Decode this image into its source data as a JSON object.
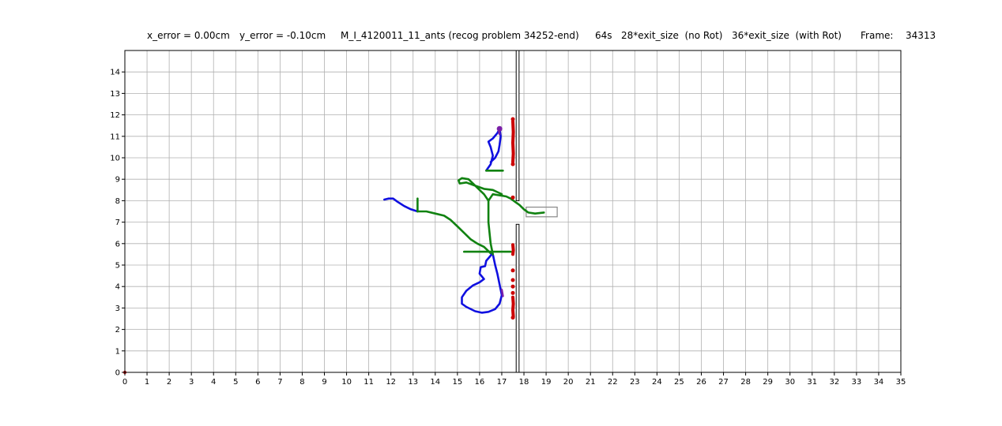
{
  "title_parts": {
    "x_error": "x_error = 0.00cm",
    "y_error": "y_error = -0.10cm",
    "experiment": "M_I_4120011_11_ants (recog problem 34252-end)",
    "time": "64s",
    "no_rot": "28*exit_size  (no Rot)",
    "with_rot": "36*exit_size  (with Rot)",
    "frame_label": "Frame:",
    "frame_value": "34313"
  },
  "chart_data": {
    "type": "line",
    "xlim": [
      0,
      35
    ],
    "ylim": [
      0,
      15
    ],
    "xticks": [
      0,
      1,
      2,
      3,
      4,
      5,
      6,
      7,
      8,
      9,
      10,
      11,
      12,
      13,
      14,
      15,
      16,
      17,
      18,
      19,
      20,
      21,
      22,
      23,
      24,
      25,
      26,
      27,
      28,
      29,
      30,
      31,
      32,
      33,
      34,
      35
    ],
    "yticks": [
      0,
      1,
      2,
      3,
      4,
      5,
      6,
      7,
      8,
      9,
      10,
      11,
      12,
      13,
      14
    ],
    "grid": true,
    "colors": {
      "blue": "#1010e0",
      "green": "#118211",
      "red": "#cc0000",
      "purple": "#7a1fa8",
      "gray_box": "#888888"
    },
    "walls": [
      {
        "x": [
          17.65,
          17.78
        ],
        "y": [
          8.0,
          15.0
        ]
      },
      {
        "x": [
          17.65,
          17.78
        ],
        "y": [
          0.0,
          6.9
        ]
      }
    ],
    "exit_box": {
      "x": [
        18.1,
        19.5
      ],
      "y": [
        7.25,
        7.7
      ]
    },
    "series": [
      {
        "color": "blue",
        "values": [
          [
            11.7,
            8.05
          ],
          [
            11.9,
            8.1
          ],
          [
            12.1,
            8.1
          ],
          [
            12.3,
            7.95
          ],
          [
            12.6,
            7.75
          ],
          [
            12.9,
            7.6
          ],
          [
            13.2,
            7.5
          ]
        ]
      },
      {
        "color": "green",
        "values": [
          [
            13.2,
            7.5
          ],
          [
            13.6,
            7.5
          ],
          [
            14.0,
            7.4
          ],
          [
            14.4,
            7.3
          ],
          [
            14.7,
            7.1
          ],
          [
            15.0,
            6.8
          ],
          [
            15.3,
            6.5
          ],
          [
            15.6,
            6.2
          ],
          [
            15.9,
            6.0
          ],
          [
            16.2,
            5.85
          ],
          [
            16.4,
            5.65
          ],
          [
            16.55,
            5.5
          ]
        ]
      },
      {
        "color": "blue",
        "values": [
          [
            16.55,
            5.5
          ],
          [
            16.3,
            5.2
          ],
          [
            16.25,
            4.95
          ],
          [
            16.05,
            4.9
          ],
          [
            16.0,
            4.6
          ],
          [
            16.2,
            4.35
          ],
          [
            16.0,
            4.2
          ],
          [
            15.7,
            4.05
          ],
          [
            15.4,
            3.8
          ],
          [
            15.2,
            3.5
          ],
          [
            15.2,
            3.2
          ],
          [
            15.4,
            3.05
          ],
          [
            15.8,
            2.85
          ],
          [
            16.1,
            2.78
          ],
          [
            16.4,
            2.82
          ],
          [
            16.7,
            2.95
          ],
          [
            16.9,
            3.2
          ],
          [
            17.0,
            3.6
          ],
          [
            16.9,
            4.1
          ],
          [
            16.8,
            4.6
          ],
          [
            16.7,
            5.0
          ],
          [
            16.6,
            5.5
          ]
        ]
      },
      {
        "color": "green",
        "values": [
          [
            16.6,
            5.5
          ],
          [
            16.5,
            6.0
          ],
          [
            16.45,
            6.5
          ],
          [
            16.4,
            7.0
          ],
          [
            16.4,
            7.5
          ],
          [
            16.4,
            8.0
          ],
          [
            16.6,
            8.3
          ],
          [
            16.9,
            8.25
          ],
          [
            17.2,
            8.2
          ],
          [
            17.4,
            8.1
          ],
          [
            17.6,
            7.95
          ],
          [
            17.8,
            7.8
          ],
          [
            18.0,
            7.6
          ],
          [
            18.2,
            7.45
          ],
          [
            18.5,
            7.4
          ],
          [
            18.9,
            7.45
          ]
        ]
      },
      {
        "color": "green",
        "values": [
          [
            16.4,
            8.0
          ],
          [
            16.2,
            8.3
          ],
          [
            16.0,
            8.5
          ],
          [
            15.7,
            8.8
          ],
          [
            15.5,
            9.0
          ],
          [
            15.2,
            9.05
          ],
          [
            15.05,
            8.95
          ],
          [
            15.1,
            8.8
          ],
          [
            15.4,
            8.85
          ],
          [
            15.8,
            8.7
          ],
          [
            16.2,
            8.55
          ],
          [
            16.6,
            8.5
          ],
          [
            16.8,
            8.4
          ],
          [
            17.0,
            8.3
          ]
        ]
      },
      {
        "color": "blue",
        "values": [
          [
            16.3,
            9.4
          ],
          [
            16.5,
            9.7
          ],
          [
            16.6,
            10.1
          ],
          [
            16.5,
            10.5
          ],
          [
            16.4,
            10.75
          ],
          [
            16.6,
            10.9
          ],
          [
            16.8,
            11.15
          ],
          [
            16.9,
            11.35
          ],
          [
            16.95,
            11.0
          ],
          [
            16.9,
            10.6
          ],
          [
            16.85,
            10.3
          ],
          [
            16.7,
            10.0
          ],
          [
            16.5,
            9.8
          ]
        ]
      },
      {
        "color": "green",
        "values": [
          [
            16.3,
            9.4
          ],
          [
            17.05,
            9.4
          ]
        ]
      },
      {
        "color": "green",
        "values": [
          [
            13.2,
            8.1
          ],
          [
            13.2,
            7.5
          ]
        ]
      },
      {
        "color": "green",
        "values": [
          [
            15.3,
            5.62
          ],
          [
            17.4,
            5.62
          ]
        ]
      },
      {
        "color": "purple",
        "values": [
          [
            16.85,
            11.35
          ],
          [
            16.9,
            11.1
          ]
        ]
      },
      {
        "color": "purple",
        "values": [
          [
            17.0,
            3.85
          ],
          [
            17.05,
            3.55
          ]
        ]
      },
      {
        "color": "red",
        "values": [
          [
            17.5,
            11.7
          ],
          [
            17.52,
            11.2
          ],
          [
            17.5,
            10.7
          ],
          [
            17.52,
            10.2
          ],
          [
            17.5,
            9.8
          ]
        ]
      },
      {
        "color": "red",
        "values": [
          [
            17.5,
            5.95
          ],
          [
            17.52,
            5.7
          ],
          [
            17.5,
            5.5
          ]
        ]
      },
      {
        "color": "red",
        "values": [
          [
            17.5,
            3.5
          ],
          [
            17.52,
            3.2
          ],
          [
            17.5,
            2.9
          ],
          [
            17.52,
            2.6
          ]
        ]
      }
    ],
    "red_points": [
      [
        17.5,
        8.15
      ],
      [
        17.5,
        4.75
      ],
      [
        17.5,
        4.3
      ],
      [
        17.5,
        4.0
      ],
      [
        17.5,
        3.7
      ],
      [
        17.5,
        11.8
      ],
      [
        17.5,
        9.7
      ],
      [
        17.5,
        2.55
      ]
    ]
  }
}
